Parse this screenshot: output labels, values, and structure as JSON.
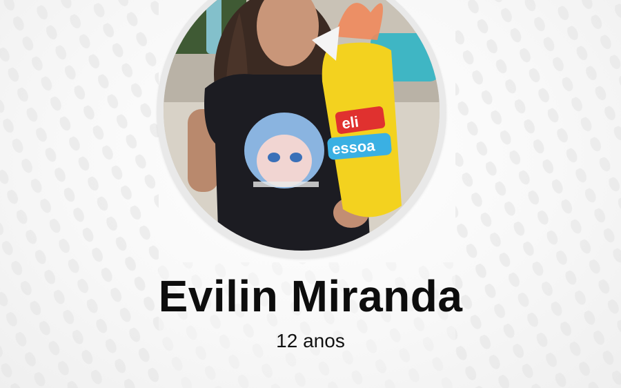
{
  "profile": {
    "name": "Evilin Miranda",
    "age": "12 anos",
    "photo_icon": "portrait-photo",
    "bag_label_top": "eli",
    "bag_label_bottom": "essoa"
  },
  "colors": {
    "background": "#f6f6f6",
    "frame": "#e9e9e9",
    "text": "#0d0d0d",
    "bag_yellow": "#f3d21f"
  }
}
